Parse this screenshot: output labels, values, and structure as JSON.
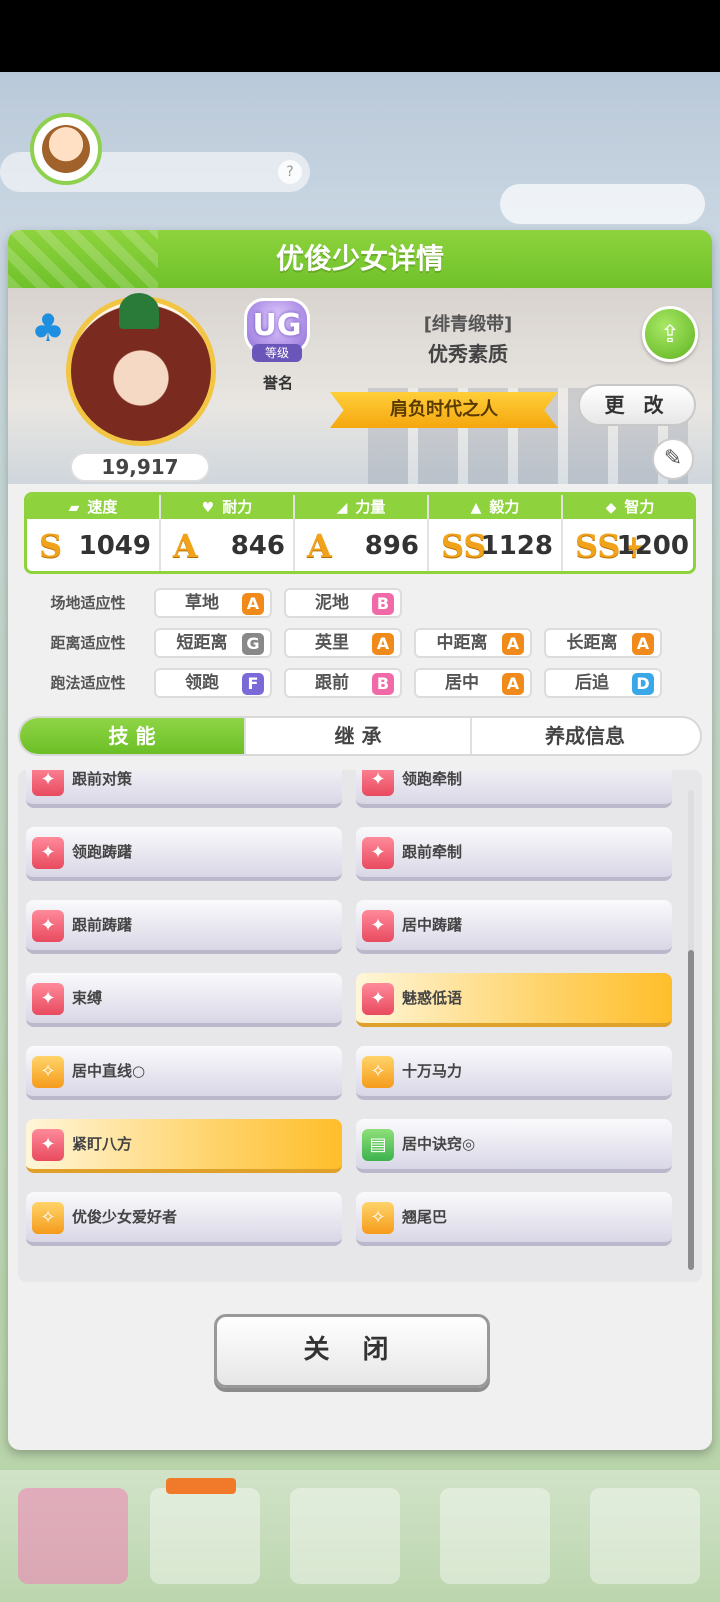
{
  "panel": {
    "title": "优俊少女详情"
  },
  "profile": {
    "fans": "19,917",
    "rank_letter": "UG",
    "rank_grade": "等级",
    "rank_label": "誉名",
    "epithet_sub": "[绯青缎带]",
    "epithet_main": "优秀素质",
    "title": "肩负时代之人",
    "change_label": "更 改"
  },
  "stats": [
    {
      "label": "速度",
      "rank": "S",
      "value": "1049",
      "icon": "shoe-icon"
    },
    {
      "label": "耐力",
      "rank": "A",
      "value": "846",
      "icon": "heart-icon"
    },
    {
      "label": "力量",
      "rank": "A",
      "value": "896",
      "icon": "arm-icon"
    },
    {
      "label": "毅力",
      "rank": "SS",
      "value": "1128",
      "icon": "flame-icon"
    },
    {
      "label": "智力",
      "rank": "SS+",
      "value": "1200",
      "icon": "cap-icon"
    }
  ],
  "aptitude": {
    "track_label": "场地适应性",
    "distance_label": "距离适应性",
    "style_label": "跑法适应性",
    "track": [
      {
        "name": "草地",
        "grade": "A"
      },
      {
        "name": "泥地",
        "grade": "B"
      }
    ],
    "distance": [
      {
        "name": "短距离",
        "grade": "G"
      },
      {
        "name": "英里",
        "grade": "A"
      },
      {
        "name": "中距离",
        "grade": "A"
      },
      {
        "name": "长距离",
        "grade": "A"
      }
    ],
    "style": [
      {
        "name": "领跑",
        "grade": "F"
      },
      {
        "name": "跟前",
        "grade": "B"
      },
      {
        "name": "居中",
        "grade": "A"
      },
      {
        "name": "后追",
        "grade": "D"
      }
    ]
  },
  "tabs": [
    "技 能",
    "继 承",
    "养成信息"
  ],
  "skills": [
    {
      "name": "跟前对策",
      "color": "red",
      "gold": false
    },
    {
      "name": "领跑牵制",
      "color": "red",
      "gold": false
    },
    {
      "name": "领跑踌躇",
      "color": "red",
      "gold": false
    },
    {
      "name": "跟前牵制",
      "color": "red",
      "gold": false
    },
    {
      "name": "跟前踌躇",
      "color": "red",
      "gold": false
    },
    {
      "name": "居中踌躇",
      "color": "red",
      "gold": false
    },
    {
      "name": "束缚",
      "color": "red",
      "gold": false
    },
    {
      "name": "魅惑低语",
      "color": "red",
      "gold": true
    },
    {
      "name": "居中直线○",
      "color": "orange",
      "gold": false
    },
    {
      "name": "十万马力",
      "color": "orange",
      "gold": false
    },
    {
      "name": "紧盯八方",
      "color": "red",
      "gold": true
    },
    {
      "name": "居中诀窍◎",
      "color": "green",
      "gold": false
    },
    {
      "name": "优俊少女爱好者",
      "color": "orange",
      "gold": false
    },
    {
      "name": "翘尾巴",
      "color": "orange",
      "gold": false
    }
  ],
  "close_label": "关 闭",
  "grade_colors": {
    "S": "#f0a21a",
    "A": "#f08a1a",
    "B": "#f06aa8",
    "G": "#888888",
    "F": "#7a6ad8",
    "D": "#3aa8e8"
  }
}
